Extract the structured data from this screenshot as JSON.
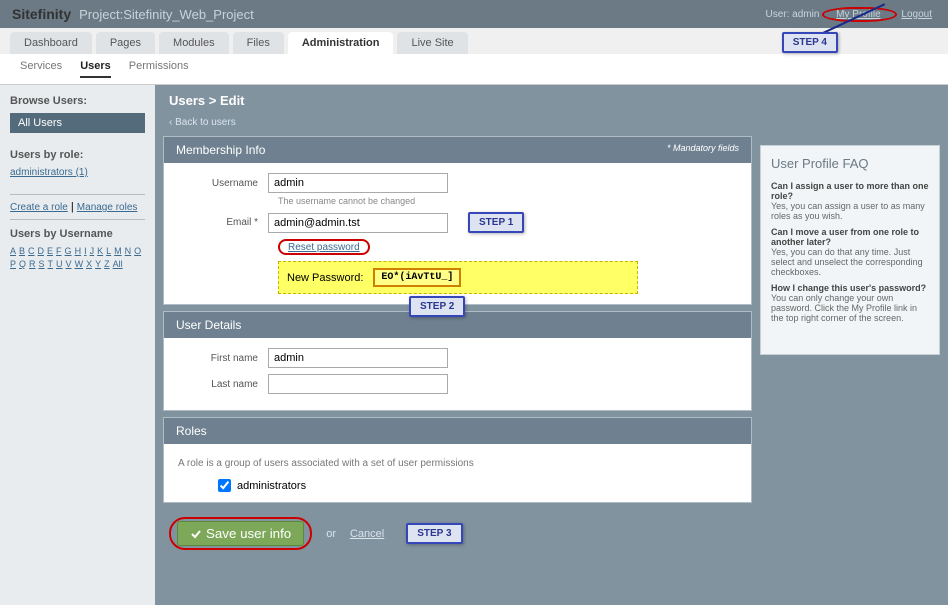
{
  "header": {
    "logo": "Sitefinity",
    "project": "Project:Sitefinity_Web_Project",
    "userLabel": "User: admin",
    "profileLink": "My Profile",
    "logoutLink": "Logout"
  },
  "mainTabs": [
    "Dashboard",
    "Pages",
    "Modules",
    "Files",
    "Administration",
    "Live Site"
  ],
  "mainTabActive": 4,
  "subTabs": [
    "Services",
    "Users",
    "Permissions"
  ],
  "subTabActive": 1,
  "sidebar": {
    "browseHeading": "Browse Users:",
    "allUsers": "All Users",
    "byRoleHeading": "Users by role:",
    "roles": [
      "administrators (1)"
    ],
    "createLink": "Create a role",
    "manageLink": "Manage roles",
    "byUsernameHeading": "Users by Username",
    "alpha": [
      "A",
      "B",
      "C",
      "D",
      "E",
      "F",
      "G",
      "H",
      "I",
      "J",
      "K",
      "L",
      "M",
      "N",
      "O",
      "P",
      "Q",
      "R",
      "S",
      "T",
      "U",
      "V",
      "W",
      "X",
      "Y",
      "Z",
      "All"
    ]
  },
  "breadcrumb": "Users > Edit",
  "backLink": "‹ Back to users",
  "membership": {
    "title": "Membership Info",
    "mandatory": "* Mandatory fields",
    "usernameLabel": "Username",
    "usernameValue": "admin",
    "usernameHint": "The username cannot be changed",
    "emailLabel": "Email *",
    "emailValue": "admin@admin.tst",
    "resetLink": "Reset password",
    "newPwLabel": "New Password:",
    "newPwValue": "EO*(iAvTtU_]"
  },
  "userDetails": {
    "title": "User Details",
    "firstLabel": "First name",
    "firstValue": "admin",
    "lastLabel": "Last name",
    "lastValue": ""
  },
  "rolesPanel": {
    "title": "Roles",
    "desc": "A role is a group of users associated with a set of user permissions",
    "roleName": "administrators"
  },
  "saveButton": "Save user info",
  "cancelLink": "Cancel",
  "steps": {
    "s1": "STEP 1",
    "s2": "STEP 2",
    "s3": "STEP 3",
    "s4": "STEP 4"
  },
  "faq": {
    "title": "User Profile FAQ",
    "items": [
      {
        "q": "Can I assign a user to more than one role?",
        "a": "Yes, you can assign a user to as many roles as you wish."
      },
      {
        "q": "Can I move a user from one role to another later?",
        "a": "Yes, you can do that any time. Just select and unselect the corresponding checkboxes."
      },
      {
        "q": "How I change this user's password?",
        "a": "You can only change your own password. Click the My Profile link in the top right corner of the screen."
      }
    ]
  }
}
